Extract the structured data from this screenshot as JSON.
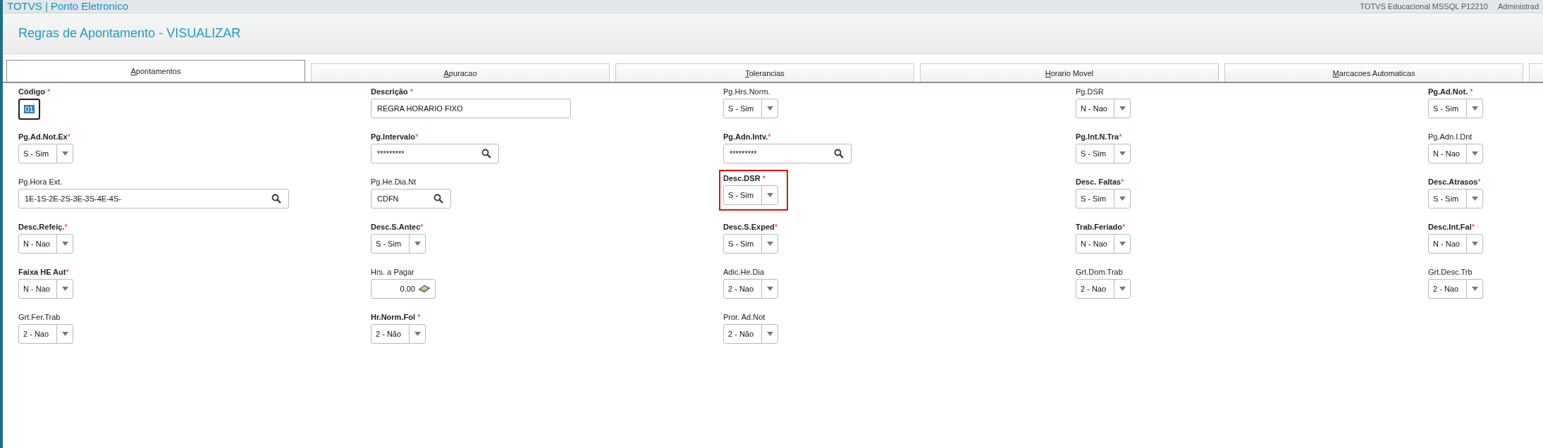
{
  "app_bar": {
    "title": "TOTVS | Ponto Eletronico",
    "environment": "TOTVS Educacional MSSQL P12210",
    "user": "Administrad"
  },
  "page_title": "Regras de Apontamento - VISUALIZAR",
  "tabs": [
    {
      "label": "Apontamentos",
      "selected": true
    },
    {
      "label": "Apuracao",
      "selected": false
    },
    {
      "label": "Tolerancias",
      "selected": false
    },
    {
      "label": "Horario Movel",
      "selected": false
    },
    {
      "label": "Marcacoes Automaticas",
      "selected": false
    },
    {
      "selected": false
    }
  ],
  "fields": [
    {
      "label": "Código",
      "required_mark": " *",
      "kind": "code",
      "value": "01"
    },
    {
      "label": "Descrição",
      "required_mark": " *",
      "kind": "text",
      "value": "REGRA HORARIO FIXO"
    },
    {
      "label": "Pg.Hrs.Norm.",
      "kind": "select",
      "value": "S - Sim"
    },
    {
      "label": "Pg.DSR",
      "kind": "select",
      "value": "N - Nao"
    },
    {
      "label": "Pg.Ad.Not.",
      "required_mark": " *",
      "kind": "select",
      "value": "S - Sim"
    },
    {
      "label": "Pg.Ad.Not.Ex",
      "required_mark": "*",
      "kind": "select",
      "value": "S - Sim"
    },
    {
      "label": "Pg.Intervalo",
      "required_mark": "*",
      "kind": "lookup",
      "value": "*********"
    },
    {
      "label": "Pg.Adn.Intv.",
      "required_mark": "*",
      "kind": "lookup",
      "value": "*********"
    },
    {
      "label": "Pg.Int.N.Tra",
      "required_mark": "*",
      "kind": "select",
      "value": "S - Sim"
    },
    {
      "label": "Pg.Adn.I.Dnt",
      "kind": "select",
      "value": "N - Nao"
    },
    {
      "label": "Pg.Hora Ext.",
      "kind": "lookup",
      "value": "1E-1S-2E-2S-3E-3S-4E-4S-"
    },
    {
      "label": "Pg.He.Dia.Nt",
      "kind": "lookup",
      "value": "CDFN"
    },
    {
      "label": "Desc.DSR",
      "required_mark": " *",
      "kind": "select",
      "value": "S - Sim",
      "highlighted": true
    },
    {
      "label": "Desc. Faltas",
      "required_mark": "*",
      "kind": "select",
      "value": "S - Sim"
    },
    {
      "label": "Desc.Atrasos",
      "required_mark": "*",
      "kind": "select",
      "value": "S - Sim"
    },
    {
      "label": "Desc.Refeiç.",
      "required_mark": "*",
      "kind": "select",
      "value": "N - Nao"
    },
    {
      "label": "Desc.S.Antec",
      "required_mark": "*",
      "kind": "select",
      "value": "S - Sim"
    },
    {
      "label": "Desc.S.Exped",
      "required_mark": "*",
      "kind": "select",
      "value": "S - Sim"
    },
    {
      "label": "Trab.Feriado",
      "required_mark": "*",
      "kind": "select",
      "value": "N - Nao"
    },
    {
      "label": "Desc.Int.Fal",
      "required_mark": "*",
      "kind": "select",
      "value": "N - Nao"
    },
    {
      "label": "Faixa HE Aut",
      "required_mark": "*",
      "kind": "select",
      "value": "N - Nao"
    },
    {
      "label": "Hrs. a Pagar",
      "kind": "currency",
      "value": "0.00"
    },
    {
      "label": "Adic.He.Dia",
      "kind": "select",
      "value": "2 - Nao"
    },
    {
      "label": "Grt.Dom.Trab",
      "kind": "select",
      "value": "2 - Nao"
    },
    {
      "label": "Grt.Desc.Trb",
      "kind": "select",
      "value": "2 - Nao"
    },
    {
      "label": "Grt.Fer.Trab",
      "kind": "select",
      "value": "2 - Nao"
    },
    {
      "label": "Hr.Norm.Fol",
      "required_mark": " *",
      "kind": "select",
      "value": "2 - Não"
    },
    {
      "label": "Pror. Ad.Not",
      "kind": "select",
      "value": "2 - Não"
    }
  ]
}
